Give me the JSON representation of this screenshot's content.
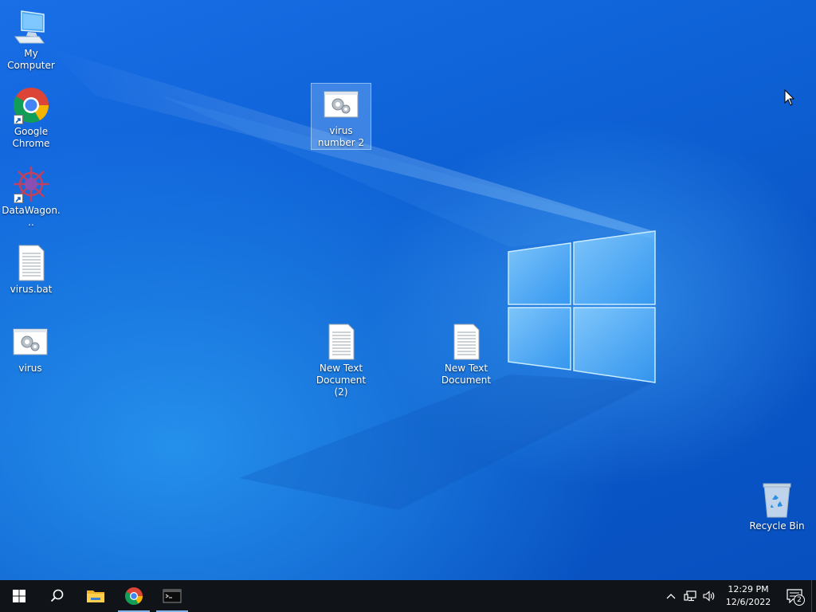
{
  "desktop": {
    "icons": {
      "my_computer": {
        "label": "My Computer",
        "icon": "computer-icon"
      },
      "google_chrome": {
        "label": "Google Chrome",
        "icon": "chrome-icon",
        "shortcut": true
      },
      "datawagon": {
        "label": "DataWagon...",
        "icon": "datawagon-icon",
        "shortcut": true
      },
      "virus_bat": {
        "label": "virus.bat",
        "icon": "text-file-icon"
      },
      "virus": {
        "label": "virus",
        "icon": "executable-icon"
      },
      "virus_number_2": {
        "label": "virus number 2",
        "icon": "executable-icon",
        "selected": true
      },
      "new_text_document_2": {
        "label": "New Text Document (2)",
        "icon": "text-file-icon"
      },
      "new_text_document": {
        "label": "New Text Document",
        "icon": "text-file-icon"
      },
      "recycle_bin": {
        "label": "Recycle Bin",
        "icon": "recycle-bin-icon"
      }
    }
  },
  "taskbar": {
    "buttons": [
      "start-icon",
      "search-icon",
      "file-explorer-icon",
      "chrome-icon",
      "terminal-icon"
    ],
    "clock": {
      "time": "12:29 PM",
      "date": "12/6/2022"
    },
    "notifications": {
      "count": "2"
    }
  },
  "colors": {
    "taskbar_bg": "#101418",
    "wallpaper_primary": "#0e62d6",
    "active_indicator": "#7fb4e8"
  }
}
